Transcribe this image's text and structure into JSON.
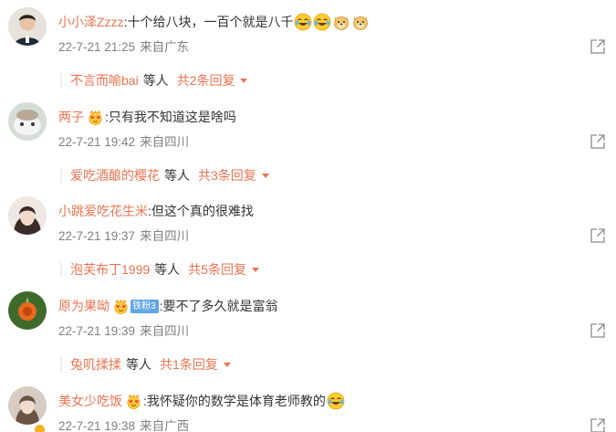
{
  "comments": [
    {
      "user": "小小泽Zzzz",
      "text": "十个给八块，一百个就是八千",
      "emojis": [
        "laugh-cry-emoji",
        "laugh-cry-emoji",
        "doge-emoji",
        "doge-emoji"
      ],
      "time": "22-7-21 21:25",
      "location": "来自广东",
      "reply_user": "不言而喻bai",
      "reply_etc": "等人",
      "reply_count": "共2条回复",
      "avatar_color": "#2b3a4e"
    },
    {
      "user": "两子",
      "text": "只有我不知道这是啥吗",
      "time": "22-7-21 19:42",
      "location": "来自四川",
      "reply_user": "爱吃酒酿的樱花",
      "reply_etc": "等人",
      "reply_count": "共3条回复",
      "avatar_color": "#c9cfc9"
    },
    {
      "user": "小跳爱吃花生米",
      "text": "但这个真的很难找",
      "time": "22-7-21 19:37",
      "location": "来自四川",
      "reply_user": "泡芙布丁1999",
      "reply_etc": "等人",
      "reply_count": "共5条回复",
      "avatar_color": "#5a4a48"
    },
    {
      "user": "原为果呦",
      "fan_badge": "铁粉3",
      "text": "要不了多久就是富翁",
      "time": "22-7-21 19:39",
      "location": "来自四川",
      "reply_user": "兔叽揉揉",
      "reply_etc": "等人",
      "reply_count": "共1条回复",
      "avatar_color": "#3f6a2c"
    },
    {
      "user": "美女少吃饭",
      "text": "我怀疑你的数学是体育老师教的",
      "emojis": [
        "laugh-cry-emoji"
      ],
      "time": "22-7-21 19:38",
      "location": "来自广西",
      "avatar_color": "#b9a898"
    }
  ],
  "colon": ":",
  "accent_color": "#eb7350"
}
